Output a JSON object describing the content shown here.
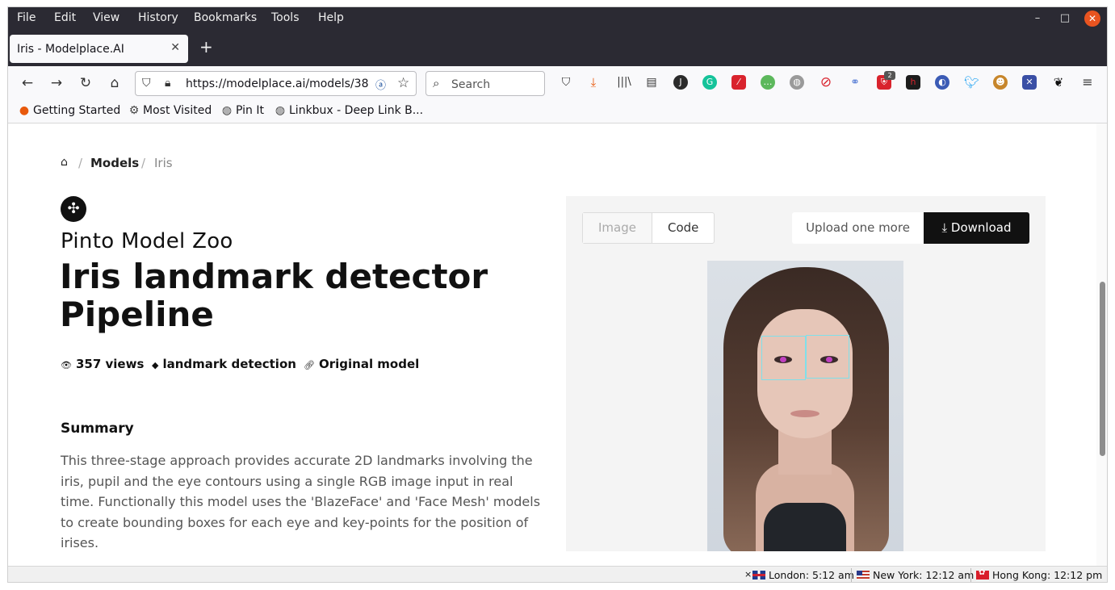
{
  "browser": {
    "menu": [
      "File",
      "Edit",
      "View",
      "History",
      "Bookmarks",
      "Tools",
      "Help"
    ],
    "tab_title": "Iris - Modelplace.AI",
    "url": "https://modelplace.ai/models/38",
    "search_placeholder": "Search",
    "extensions_badge": "2",
    "bookmarks": [
      "Getting Started",
      "Most Visited",
      "Pin It",
      "Linkbux - Deep Link B..."
    ]
  },
  "page": {
    "breadcrumb": {
      "models": "Models",
      "current": "Iris"
    },
    "org": "Pinto Model Zoo",
    "title": "Iris landmark detector Pipeline",
    "meta": {
      "views": "357 views",
      "tag": "landmark detection",
      "link": "Original model"
    },
    "summary_heading": "Summary",
    "summary_text": "This three-stage approach provides accurate 2D landmarks involving the iris, pupil and the eye contours using a single RGB image input in real time. Functionally this model uses the 'BlazeFace' and 'Face Mesh' models to create bounding boxes for each eye and key-points for the position of irises.",
    "demo": {
      "tab_image": "Image",
      "tab_code": "Code",
      "upload_label": "Upload one more",
      "download_label": "Download",
      "download_icon": "⤓"
    }
  },
  "statusbar": {
    "close_glyph": "×",
    "clocks": [
      "London: 5:12 am",
      "New York: 12:12 am",
      "Hong Kong: 12:12 pm"
    ]
  },
  "colors": {
    "accent_dark": "#111111",
    "bbox": "#7fe0ea",
    "titlebar": "#2b2a33"
  }
}
